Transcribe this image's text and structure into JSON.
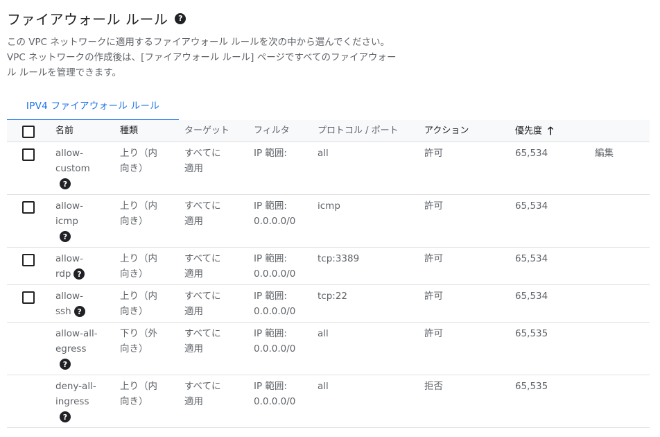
{
  "header": {
    "title": "ファイアウォール ルール",
    "description": "この VPC ネットワークに適用するファイアウォール ルールを次の中から選んでください。VPC ネットワークの作成後は、[ファイアウォール ルール] ページですべてのファイアウォール ルールを管理できます。",
    "help_glyph": "?"
  },
  "tabs": [
    {
      "label": "IPV4 ファイアウォール ルール",
      "active": true
    }
  ],
  "table": {
    "columns": {
      "name": "名前",
      "type": "種類",
      "target": "ターゲット",
      "filter": "フィルタ",
      "protocol": "プロトコル / ポート",
      "action": "アクション",
      "priority": "優先度"
    },
    "sort_indicator": "🡑",
    "edit_label": "編集",
    "rows": [
      {
        "name": [
          "allow-",
          "custom"
        ],
        "help": "block",
        "type": [
          "上り（内",
          "向き）"
        ],
        "target": [
          "すべてに",
          "適用"
        ],
        "filter": [
          "IP 範囲:",
          ""
        ],
        "protocol": "all",
        "action": "許可",
        "priority": "65,534",
        "checkbox": true,
        "edit": true
      },
      {
        "name": [
          "allow-",
          "icmp"
        ],
        "help": "block",
        "type": [
          "上り（内",
          "向き）"
        ],
        "target": [
          "すべてに",
          "適用"
        ],
        "filter": [
          "IP 範囲:",
          "0.0.0.0/0"
        ],
        "protocol": "icmp",
        "action": "許可",
        "priority": "65,534",
        "checkbox": true,
        "edit": false
      },
      {
        "name": [
          "allow-",
          "rdp"
        ],
        "help": "inline",
        "type": [
          "上り（内",
          "向き）"
        ],
        "target": [
          "すべてに",
          "適用"
        ],
        "filter": [
          "IP 範囲:",
          "0.0.0.0/0"
        ],
        "protocol": "tcp:3389",
        "action": "許可",
        "priority": "65,534",
        "checkbox": true,
        "edit": false
      },
      {
        "name": [
          "allow-",
          "ssh"
        ],
        "help": "inline",
        "type": [
          "上り（内",
          "向き）"
        ],
        "target": [
          "すべてに",
          "適用"
        ],
        "filter": [
          "IP 範囲:",
          "0.0.0.0/0"
        ],
        "protocol": "tcp:22",
        "action": "許可",
        "priority": "65,534",
        "checkbox": true,
        "edit": false
      },
      {
        "name": [
          "allow-all-",
          "egress"
        ],
        "help": "block",
        "type": [
          "下り（外",
          "向き）"
        ],
        "target": [
          "すべてに",
          "適用"
        ],
        "filter": [
          "IP 範囲:",
          "0.0.0.0/0"
        ],
        "protocol": "all",
        "action": "許可",
        "priority": "65,535",
        "checkbox": false,
        "edit": false
      },
      {
        "name": [
          "deny-all-",
          "ingress"
        ],
        "help": "block",
        "type": [
          "上り（内",
          "向き）"
        ],
        "target": [
          "すべてに",
          "適用"
        ],
        "filter": [
          "IP 範囲:",
          "0.0.0.0/0"
        ],
        "protocol": "all",
        "action": "拒否",
        "priority": "65,535",
        "checkbox": false,
        "edit": false
      }
    ]
  },
  "colors": {
    "accent": "#1a73e8",
    "text_primary": "#202124",
    "text_secondary": "#5f6368",
    "divider": "#e0e0e0"
  }
}
